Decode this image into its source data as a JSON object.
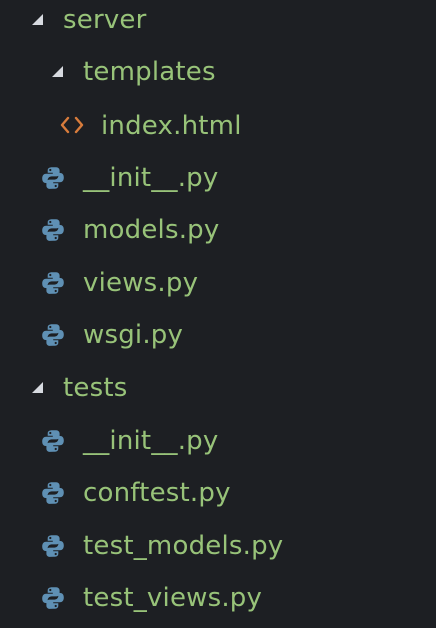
{
  "tree": {
    "items": [
      {
        "label": "server",
        "kind": "folder",
        "expanded": true,
        "depth": 0,
        "icon": "chevron-down-icon"
      },
      {
        "label": "templates",
        "kind": "folder",
        "expanded": true,
        "depth": 1,
        "icon": "chevron-down-icon"
      },
      {
        "label": "index.html",
        "kind": "file",
        "depth": 2,
        "icon": "html-file-icon"
      },
      {
        "label": "__init__.py",
        "kind": "file",
        "depth": 1,
        "icon": "python-file-icon"
      },
      {
        "label": "models.py",
        "kind": "file",
        "depth": 1,
        "icon": "python-file-icon"
      },
      {
        "label": "views.py",
        "kind": "file",
        "depth": 1,
        "icon": "python-file-icon"
      },
      {
        "label": "wsgi.py",
        "kind": "file",
        "depth": 1,
        "icon": "python-file-icon"
      },
      {
        "label": "tests",
        "kind": "folder",
        "expanded": true,
        "depth": 0,
        "icon": "chevron-down-icon"
      },
      {
        "label": "__init__.py",
        "kind": "file",
        "depth": 1,
        "icon": "python-file-icon"
      },
      {
        "label": "conftest.py",
        "kind": "file",
        "depth": 1,
        "icon": "python-file-icon"
      },
      {
        "label": "test_models.py",
        "kind": "file",
        "depth": 1,
        "icon": "python-file-icon"
      },
      {
        "label": "test_views.py",
        "kind": "file",
        "depth": 1,
        "icon": "python-file-icon"
      }
    ]
  },
  "colors": {
    "background": "#1d1f23",
    "label": "#98c379",
    "twisty": "#d7dae0",
    "python_icon": "#5f90b4",
    "html_icon": "#d87c3c"
  }
}
